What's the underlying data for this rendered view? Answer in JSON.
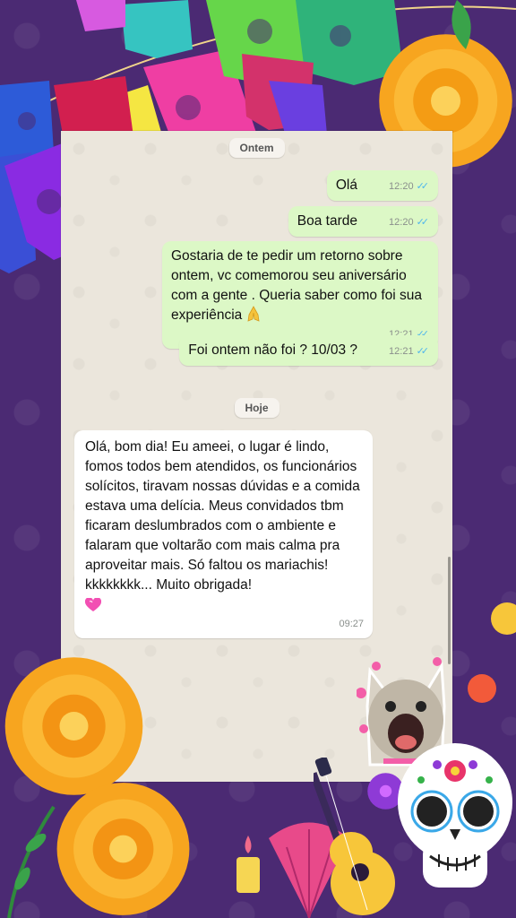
{
  "date_labels": {
    "yesterday": "Ontem",
    "today": "Hoje"
  },
  "messages": [
    {
      "text": "Olá",
      "time": "12:20"
    },
    {
      "text": "Boa tarde",
      "time": "12:20"
    },
    {
      "text": "Gostaria de te pedir um retorno sobre ontem, vc comemorou seu aniversário com a gente . Queria saber como foi sua experiência",
      "emoji": "pray-emoji",
      "time": "12:21"
    },
    {
      "text": "Foi ontem não foi ? 10/03 ?",
      "time": "12:21"
    },
    {
      "text": "Olá, bom dia! Eu ameei, o lugar é lindo, fomos todos bem atendidos, os funcionários solícitos, tiravam nossas dúvidas e a comida estava uma delícia. Meus convidados tbm ficaram deslumbrados com o ambiente e falaram que voltarão com mais calma pra aproveitar mais. Só faltou os mariachis! kkkkkkkk... Muito obrigada!",
      "emoji": "pink-heart-emoji",
      "time": "09:27"
    }
  ],
  "colors": {
    "background": "#4b2a73",
    "chat_background": "#ebe6dc",
    "outgoing_bubble": "#dcf8c6",
    "incoming_bubble": "#ffffff",
    "read_ticks": "#4fb6ec"
  },
  "icons": [
    "double-check-icon",
    "pray-emoji",
    "pink-heart-emoji",
    "cat-sticker",
    "marigold-flower",
    "sugar-skull",
    "guitar",
    "papel-picado-banner"
  ]
}
